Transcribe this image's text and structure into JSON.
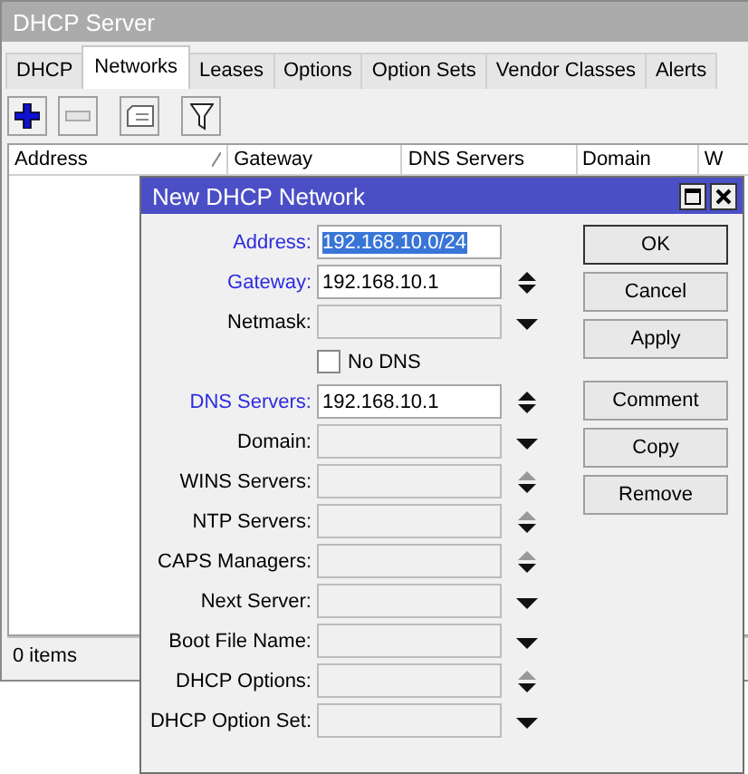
{
  "window": {
    "title": "DHCP Server"
  },
  "tabs": [
    {
      "label": "DHCP",
      "selected": false
    },
    {
      "label": "Networks",
      "selected": true
    },
    {
      "label": "Leases",
      "selected": false
    },
    {
      "label": "Options",
      "selected": false
    },
    {
      "label": "Option Sets",
      "selected": false
    },
    {
      "label": "Vendor Classes",
      "selected": false
    },
    {
      "label": "Alerts",
      "selected": false
    }
  ],
  "toolbar": [
    {
      "kind": "add",
      "disabled": false
    },
    {
      "kind": "remove",
      "disabled": true
    },
    {
      "kind": "comment",
      "disabled": false
    },
    {
      "kind": "filter",
      "disabled": false
    }
  ],
  "table": {
    "columns": [
      {
        "label": "Address",
        "sorted": true
      },
      {
        "label": "Gateway",
        "sorted": false
      },
      {
        "label": "DNS Servers",
        "sorted": false
      },
      {
        "label": "Domain",
        "sorted": false
      },
      {
        "label": "W",
        "sorted": false
      }
    ]
  },
  "status_bar": "0 items",
  "dialog": {
    "title": "New DHCP Network",
    "rows": [
      {
        "kind": "field",
        "label": "Address:",
        "required": true,
        "value": "192.168.10.0/24",
        "value_selected": true,
        "disabled": false,
        "up_arrow": false,
        "down_arrow": false
      },
      {
        "kind": "field",
        "label": "Gateway:",
        "required": true,
        "value": "192.168.10.1",
        "value_selected": false,
        "disabled": false,
        "up_arrow": true,
        "up_enabled": true,
        "down_arrow": true
      },
      {
        "kind": "field",
        "label": "Netmask:",
        "required": false,
        "disabled": true,
        "up_arrow": false,
        "down_arrow": true
      },
      {
        "kind": "checkbox",
        "label": "No DNS",
        "checked": false
      },
      {
        "kind": "field",
        "label": "DNS Servers:",
        "required": true,
        "value": "192.168.10.1",
        "value_selected": false,
        "disabled": false,
        "up_arrow": true,
        "up_enabled": true,
        "down_arrow": true
      },
      {
        "kind": "field",
        "label": "Domain:",
        "required": false,
        "disabled": true,
        "up_arrow": false,
        "down_arrow": true
      },
      {
        "kind": "field",
        "label": "WINS Servers:",
        "required": false,
        "disabled": true,
        "up_arrow": true,
        "up_enabled": false,
        "down_arrow": true
      },
      {
        "kind": "field",
        "label": "NTP Servers:",
        "required": false,
        "disabled": true,
        "up_arrow": true,
        "up_enabled": false,
        "down_arrow": true
      },
      {
        "kind": "field",
        "label": "CAPS Managers:",
        "required": false,
        "disabled": true,
        "up_arrow": true,
        "up_enabled": false,
        "down_arrow": true
      },
      {
        "kind": "field",
        "label": "Next Server:",
        "required": false,
        "disabled": true,
        "up_arrow": false,
        "down_arrow": true
      },
      {
        "kind": "field",
        "label": "Boot File Name:",
        "required": false,
        "disabled": true,
        "up_arrow": false,
        "down_arrow": true
      },
      {
        "kind": "field",
        "label": "DHCP Options:",
        "required": false,
        "disabled": true,
        "up_arrow": true,
        "up_enabled": false,
        "down_arrow": true
      },
      {
        "kind": "field",
        "label": "DHCP Option Set:",
        "required": false,
        "disabled": true,
        "up_arrow": false,
        "down_arrow": true
      }
    ],
    "button_groups": [
      [
        {
          "label": "OK",
          "default": true
        },
        {
          "label": "Cancel",
          "default": false
        },
        {
          "label": "Apply",
          "default": false
        }
      ],
      [
        {
          "label": "Comment",
          "default": false
        },
        {
          "label": "Copy",
          "default": false
        },
        {
          "label": "Remove",
          "default": false
        }
      ]
    ]
  }
}
